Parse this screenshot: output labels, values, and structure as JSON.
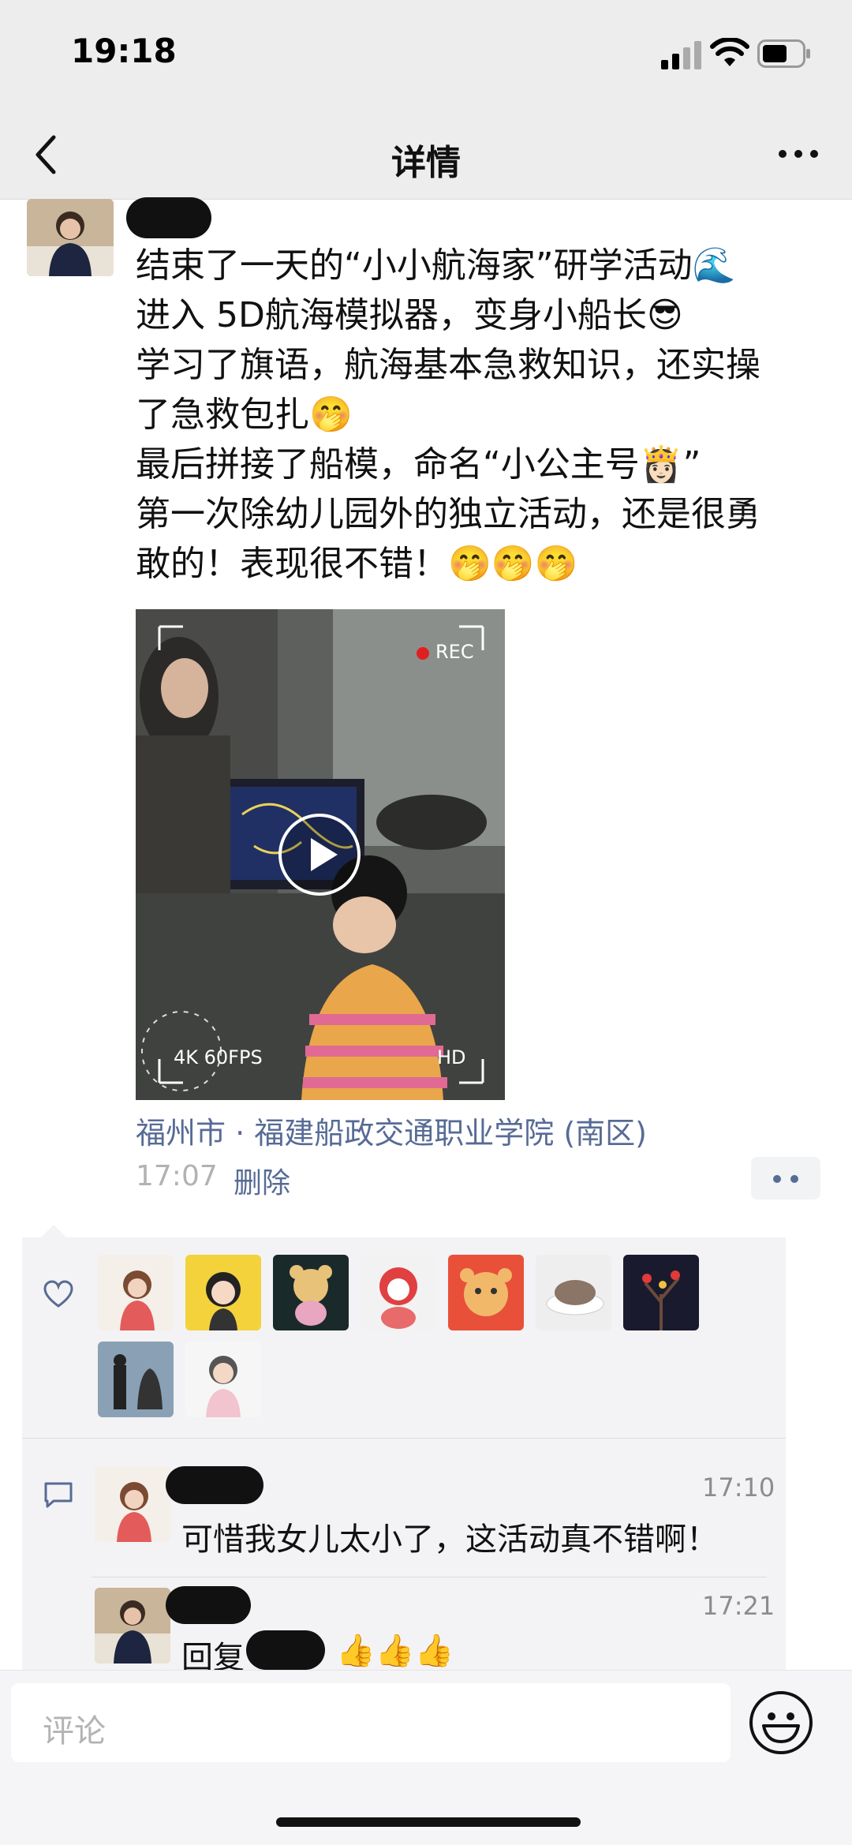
{
  "status": {
    "time": "19:18"
  },
  "nav": {
    "title": "详情"
  },
  "post": {
    "lines": [
      "结束了一天的“小小航海家”研学活动🌊",
      "进入 5D航海模拟器，变身小船长😎",
      "学习了旗语，航海基本急救知识，还实操",
      "了急救包扎🤭",
      "最后拼接了船模，命名“小公主号👸🏻”",
      "第一次除幼儿园外的独立活动，还是很勇",
      "敢的！表现很不错！🤭🤭🤭"
    ],
    "video": {
      "rec": "REC",
      "resolution": "4K 60FPS",
      "quality": "HD"
    },
    "location": "福州市 · 福建船政交通职业学院 (南区)",
    "time": "17:07",
    "delete_label": "删除"
  },
  "comments": [
    {
      "time": "17:10",
      "text": "可惜我女儿太小了，这活动真不错啊！"
    },
    {
      "time": "17:21",
      "reply_prefix": "回复",
      "text": "👍👍👍"
    }
  ],
  "input": {
    "placeholder": "评论"
  },
  "colors": {
    "link": "#576b95",
    "panel": "#f3f3f5",
    "nav_bg": "#ededed"
  }
}
